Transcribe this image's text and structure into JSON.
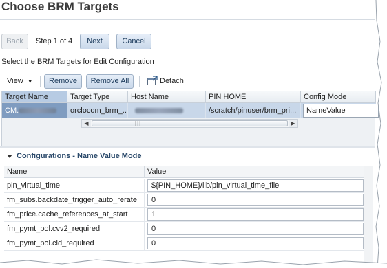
{
  "page": {
    "title": "Choose BRM Targets"
  },
  "wizard": {
    "back_label": "Back",
    "step_text": "Step 1 of 4",
    "next_label": "Next",
    "cancel_label": "Cancel",
    "instruction": "Select the BRM Targets for Edit Configuration"
  },
  "toolbar": {
    "view_label": "View",
    "remove_label": "Remove",
    "remove_all_label": "Remove All",
    "detach_label": "Detach"
  },
  "targets_table": {
    "columns": [
      "Target Name",
      "Target Type",
      "Host Name",
      "PIN HOME",
      "Config Mode"
    ],
    "rows": [
      {
        "target_name": "CM.",
        "target_type": "orclocom_brm_...",
        "host_name": "",
        "pin_home": "/scratch/pinuser/brm_pri...",
        "config_mode": "NameValue"
      }
    ]
  },
  "configurations": {
    "section_title": "Configurations - Name Value Mode",
    "columns": [
      "Name",
      "Value"
    ],
    "rows": [
      {
        "name": "pin_virtual_time",
        "value": "${PIN_HOME}/lib/pin_virtual_time_file"
      },
      {
        "name": "fm_subs.backdate_trigger_auto_rerate",
        "value": "0"
      },
      {
        "name": "fm_price.cache_references_at_start",
        "value": "1"
      },
      {
        "name": "fm_pymt_pol.cvv2_required",
        "value": "0"
      },
      {
        "name": "fm_pymt_pol.cid_required",
        "value": "0"
      }
    ]
  },
  "icons": {
    "view_dropdown": "chevron-down-icon",
    "detach": "detach-icon",
    "collapse": "triangle-down-icon",
    "scroll_left": "arrow-left-icon",
    "scroll_right": "arrow-right-icon"
  },
  "colors": {
    "title": "#3a3a3a",
    "button_bg": "#c9d8ea",
    "selected_row": "#c8d7e9",
    "selected_cell": "#7f9cc0",
    "section_title": "#2b4a6b"
  }
}
